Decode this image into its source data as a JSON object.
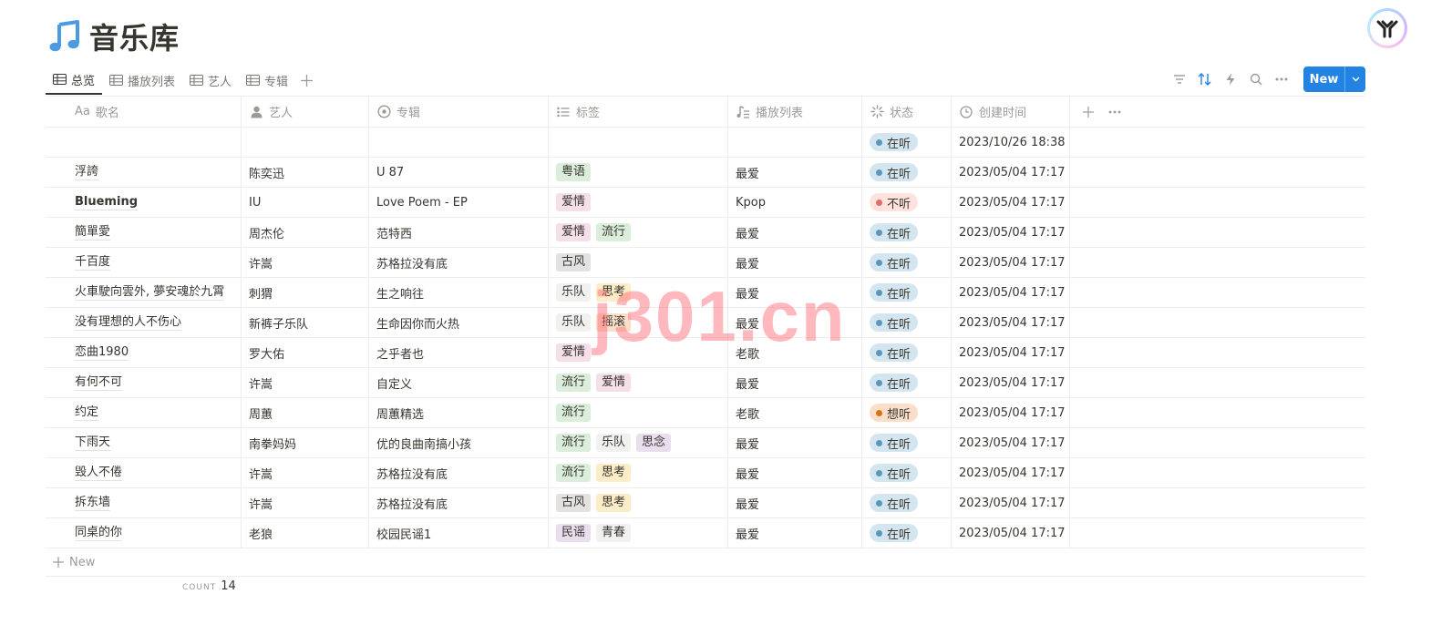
{
  "page": {
    "title": "音乐库",
    "icon": "music-note-icon"
  },
  "tabs": [
    {
      "label": "总览",
      "icon": "table-icon",
      "active": true
    },
    {
      "label": "播放列表",
      "icon": "table-icon",
      "active": false
    },
    {
      "label": "艺人",
      "icon": "table-icon",
      "active": false
    },
    {
      "label": "专辑",
      "icon": "table-icon",
      "active": false
    }
  ],
  "toolbar": {
    "new_label": "New",
    "icons": [
      "filter-icon",
      "sort-icon",
      "automation-icon",
      "search-icon",
      "more-icon"
    ],
    "accent": "#2383e2"
  },
  "columns": [
    {
      "label": "歌名",
      "icon": "title-icon",
      "prefix": "Aa"
    },
    {
      "label": "艺人",
      "icon": "person-icon"
    },
    {
      "label": "专辑",
      "icon": "relation-icon"
    },
    {
      "label": "标签",
      "icon": "multiselect-icon"
    },
    {
      "label": "播放列表",
      "icon": "playlist-icon"
    },
    {
      "label": "状态",
      "icon": "status-icon"
    },
    {
      "label": "创建时间",
      "icon": "clock-icon"
    }
  ],
  "tag_colors": {
    "粤语": "#dbeddb",
    "爱情": "#f5e0e9",
    "流行": "#dbeddb",
    "古风": "#e3e2e0",
    "乐队": "#f1f1ef",
    "思考": "#fdecc8",
    "摇滚": "#fadec9",
    "思念": "#e8deee",
    "民谣": "#e8deee",
    "青春": "#f1f1ef"
  },
  "status_colors": {
    "在听": {
      "bg": "#d3e5ef",
      "dot": "#5b97bd"
    },
    "不听": {
      "bg": "#ffe2dd",
      "dot": "#e16f64"
    },
    "想听": {
      "bg": "#fadec9",
      "dot": "#d9730d"
    }
  },
  "rows": [
    {
      "name": "",
      "artist": "",
      "album": "",
      "tags": [],
      "playlist": "",
      "status": "在听",
      "created": "2023/10/26 18:38"
    },
    {
      "name": "浮誇",
      "artist": "陈奕迅",
      "album": "U 87",
      "tags": [
        "粤语"
      ],
      "playlist": "最爱",
      "status": "在听",
      "created": "2023/05/04 17:17"
    },
    {
      "name": "Blueming",
      "bold": true,
      "artist": "IU",
      "album": "Love Poem - EP",
      "tags": [
        "爱情"
      ],
      "playlist": "Kpop",
      "status": "不听",
      "created": "2023/05/04 17:17"
    },
    {
      "name": "簡單愛",
      "artist": "周杰伦",
      "album": "范特西",
      "tags": [
        "爱情",
        "流行"
      ],
      "playlist": "最爱",
      "status": "在听",
      "created": "2023/05/04 17:17"
    },
    {
      "name": "千百度",
      "artist": "许嵩",
      "album": "苏格拉没有底",
      "tags": [
        "古风"
      ],
      "playlist": "最爱",
      "status": "在听",
      "created": "2023/05/04 17:17"
    },
    {
      "name": "火車駛向雲外, 夢安魂於九霄",
      "artist": "刺猬",
      "album": "生之响往",
      "tags": [
        "乐队",
        "思考"
      ],
      "playlist": "最爱",
      "status": "在听",
      "created": "2023/05/04 17:17"
    },
    {
      "name": "没有理想的人不伤心",
      "artist": "新裤子乐队",
      "album": "生命因你而火热",
      "tags": [
        "乐队",
        "摇滚"
      ],
      "playlist": "最爱",
      "status": "在听",
      "created": "2023/05/04 17:17"
    },
    {
      "name": "恋曲1980",
      "artist": "罗大佑",
      "album": "之乎者也",
      "tags": [
        "爱情"
      ],
      "playlist": "老歌",
      "status": "在听",
      "created": "2023/05/04 17:17"
    },
    {
      "name": "有何不可",
      "artist": "许嵩",
      "album": "自定义",
      "tags": [
        "流行",
        "爱情"
      ],
      "playlist": "最爱",
      "status": "在听",
      "created": "2023/05/04 17:17"
    },
    {
      "name": "约定",
      "artist": "周蕙",
      "album": "周蕙精选",
      "tags": [
        "流行"
      ],
      "playlist": "老歌",
      "status": "想听",
      "created": "2023/05/04 17:17"
    },
    {
      "name": "下雨天",
      "artist": "南拳妈妈",
      "album": "优的良曲南搞小孩",
      "tags": [
        "流行",
        "乐队",
        "思念"
      ],
      "playlist": "最爱",
      "status": "在听",
      "created": "2023/05/04 17:17"
    },
    {
      "name": "毁人不倦",
      "artist": "许嵩",
      "album": "苏格拉没有底",
      "tags": [
        "流行",
        "思考"
      ],
      "playlist": "最爱",
      "status": "在听",
      "created": "2023/05/04 17:17"
    },
    {
      "name": "拆东墙",
      "artist": "许嵩",
      "album": "苏格拉没有底",
      "tags": [
        "古风",
        "思考"
      ],
      "playlist": "最爱",
      "status": "在听",
      "created": "2023/05/04 17:17"
    },
    {
      "name": "同桌的你",
      "artist": "老狼",
      "album": "校园民谣1",
      "tags": [
        "民谣",
        "青春"
      ],
      "playlist": "最爱",
      "status": "在听",
      "created": "2023/05/04 17:17"
    }
  ],
  "footer": {
    "new_label": "New",
    "count_label": "COUNT",
    "count_value": "14"
  },
  "watermark": "j301.cn"
}
